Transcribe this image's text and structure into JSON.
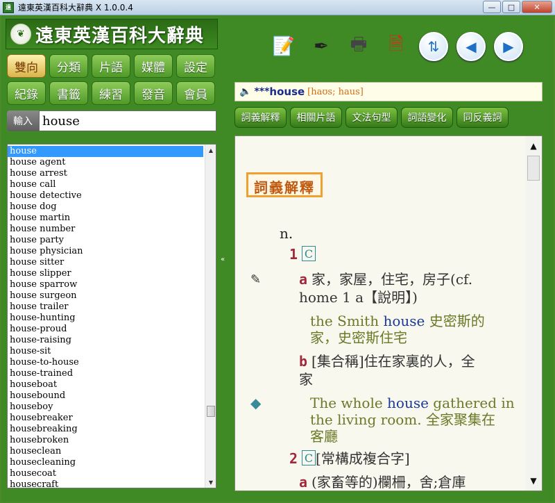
{
  "window": {
    "title": "遠東英漢百科大辭典 X 1.0.0.4",
    "icon_label": "遠",
    "minimize": "—",
    "maximize": "□",
    "close": "✕"
  },
  "logo": {
    "text": "遠東英漢百科大辭典"
  },
  "nav": {
    "row1": [
      "雙向",
      "分類",
      "片語",
      "媒體",
      "設定"
    ],
    "row2": [
      "紀錄",
      "書籤",
      "練習",
      "發音",
      "會員"
    ]
  },
  "input": {
    "label": "輸入",
    "value": "house"
  },
  "wordlist": [
    "house",
    "house agent",
    "house arrest",
    "house call",
    "house detective",
    "house dog",
    "house martin",
    "house number",
    "house party",
    "house physician",
    "house sitter",
    "house slipper",
    "house sparrow",
    "house surgeon",
    "house trailer",
    "house-hunting",
    "house-proud",
    "house-raising",
    "house-sit",
    "house-to-house",
    "house-trained",
    "houseboat",
    "housebound",
    "houseboy",
    "housebreaker",
    "housebreaking",
    "housebroken",
    "houseclean",
    "housecleaning",
    "housecoat",
    "housecraft"
  ],
  "headword": {
    "stars": "***",
    "word": "house",
    "pron": "[haʊs; haus]"
  },
  "tabs": [
    "詞義解釋",
    "相關片語",
    "文法句型",
    "詞語變化",
    "同反義詞"
  ],
  "entry": {
    "section": "詞義解釋",
    "pos": "n.",
    "s1_num": "1",
    "s1_c": "C",
    "s1a_letter": "a",
    "s1a_line1": "家，家屋，住宅，房子(cf.",
    "s1a_line2": "home 1 a【說明】)",
    "ex1_pre": "the Smith ",
    "ex1_kw": "house",
    "ex1_post": " 史密斯的",
    "ex1_line2": "家，史密斯住宅",
    "s1b_letter": "b",
    "s1b_line1": "[集合稱]住在家裏的人，全",
    "s1b_line2": "家",
    "ex2_pre": "The whole ",
    "ex2_kw": "house",
    "ex2_post": " gathered in",
    "ex2_line2": "the living room. 全家聚集在",
    "ex2_line3": "客廳",
    "s2_num": "2",
    "s2_c": "C",
    "s2_text": "[常構成複合字]",
    "s2a_letter": "a",
    "s2a_text": "(家畜等的)欄柵，舍;倉庫"
  }
}
